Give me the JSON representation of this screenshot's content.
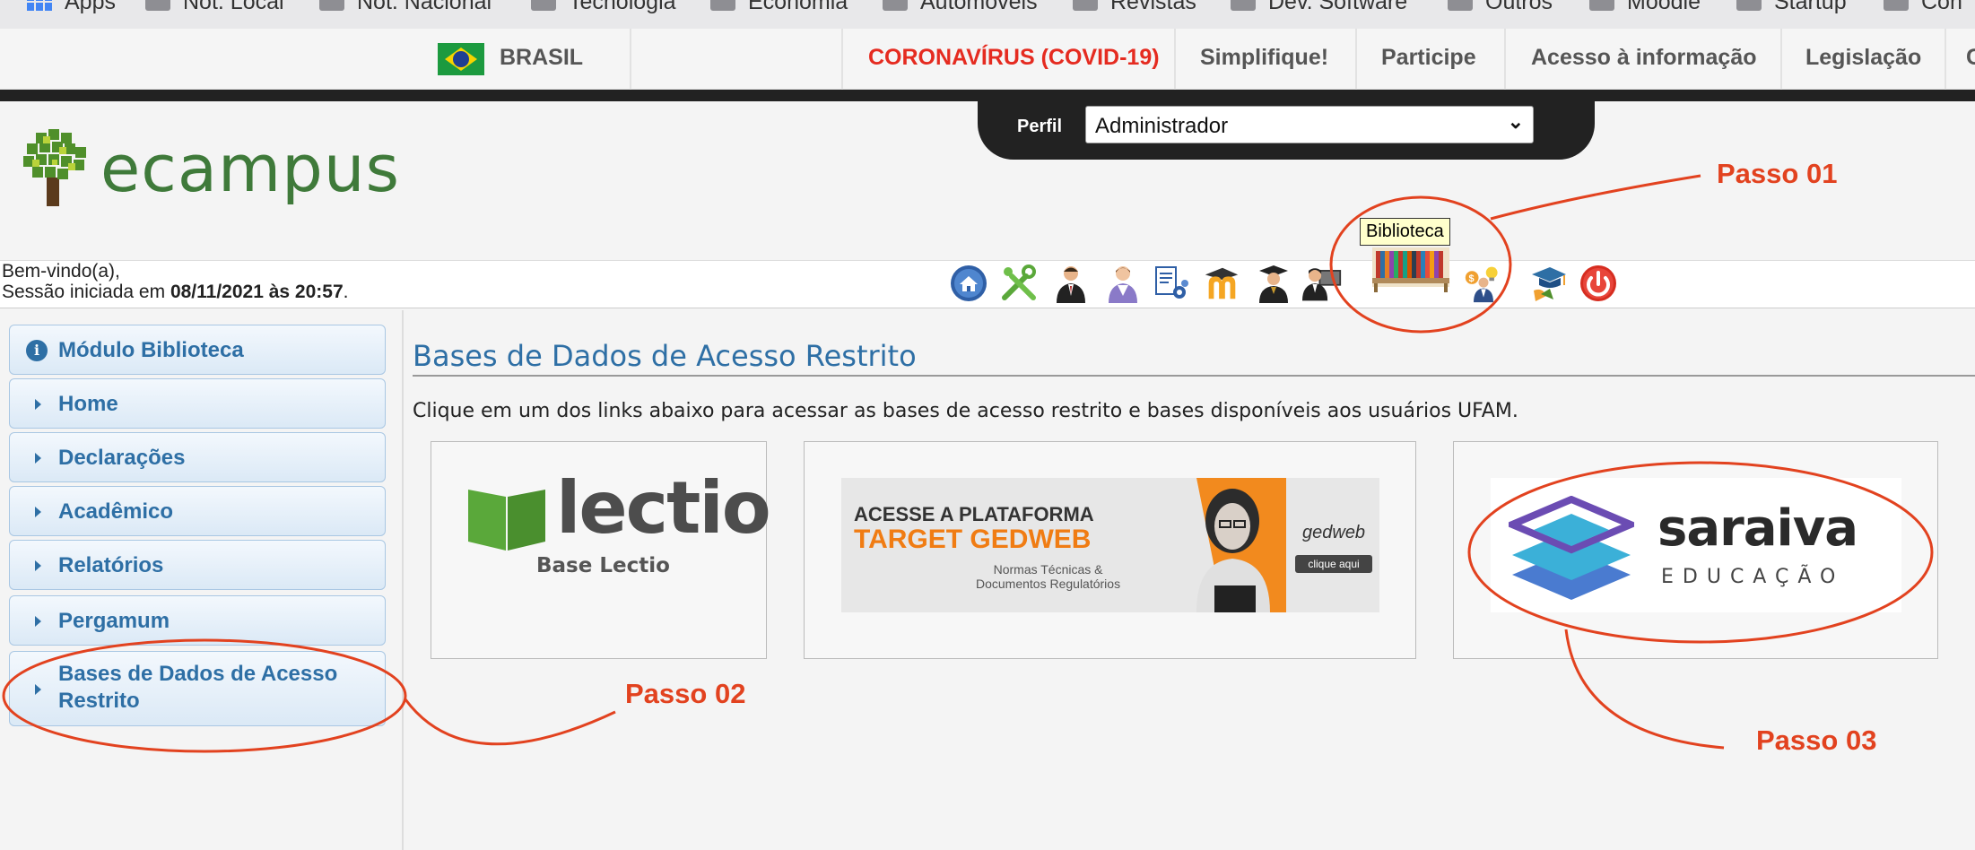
{
  "bookmarks": [
    "Apps",
    "Not. Local",
    "Not. Nacional",
    "Tecnologia",
    "Economia",
    "Automóveis",
    "Revistas",
    "Dev. Software",
    "Outros",
    "Moodle",
    "Startup",
    "Con"
  ],
  "govbar": {
    "country": "BRASIL",
    "links": [
      "CORONAVÍRUS (COVID-19)",
      "Simplifique!",
      "Participe",
      "Acesso à informação",
      "Legislação",
      "C"
    ],
    "covid_color": "#e52b20"
  },
  "header": {
    "logo_text": "ecampus",
    "perfil_label": "Perfil",
    "perfil_value": "Administrador"
  },
  "welcome": {
    "line1": "Bem-vindo(a),",
    "line2_prefix": "Sessão iniciada em ",
    "line2_datetime": "08/11/2021 às 20:57",
    "line2_suffix": "."
  },
  "toolbar": {
    "tooltip": "Biblioteca",
    "icons": [
      "home-icon",
      "tools-icon",
      "manager-icon",
      "teacher-icon",
      "documents-settings-icon",
      "moodle-icon",
      "graduate-icon",
      "professor-computer-icon",
      "library-books-icon",
      "finance-idea-icon",
      "graduation-icon",
      "power-icon"
    ]
  },
  "sidebar": {
    "items": [
      {
        "label": "Módulo Biblioteca"
      },
      {
        "label": "Home"
      },
      {
        "label": "Declarações"
      },
      {
        "label": "Acadêmico"
      },
      {
        "label": "Relatórios"
      },
      {
        "label": "Pergamum"
      },
      {
        "label": "Bases de Dados de Acesso Restrito"
      }
    ]
  },
  "main": {
    "title": "Bases de Dados de Acesso Restrito",
    "description": "Clique em um dos links abaixo para acessar as bases de acesso restrito e bases disponíveis aos usuários UFAM.",
    "cards": {
      "lectio": {
        "logo": "lectio",
        "caption": "Base Lectio"
      },
      "gedweb": {
        "line1": "ACESSE A PLATAFORMA",
        "line2": "TARGET GEDWEB",
        "small1": "Normas Técnicas &",
        "small2": "Documentos Regulatórios",
        "logo": "gedweb",
        "button": "clique aqui"
      },
      "saraiva": {
        "word": "saraiva",
        "sub": "EDUCAÇÃO"
      }
    }
  },
  "annotations": {
    "step1": "Passo 01",
    "step2": "Passo 02",
    "step3": "Passo 03",
    "color": "#e2421f"
  }
}
